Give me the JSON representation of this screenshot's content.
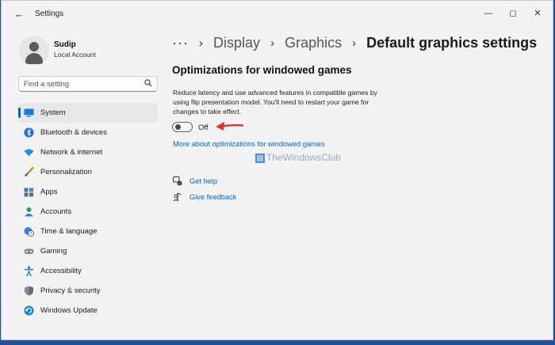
{
  "window": {
    "title": "Settings"
  },
  "user": {
    "name": "Sudip",
    "account": "Local Account"
  },
  "search": {
    "placeholder": "Find a setting"
  },
  "sidebar": {
    "items": [
      {
        "label": "System",
        "icon": "monitor-icon",
        "selected": true
      },
      {
        "label": "Bluetooth & devices",
        "icon": "bluetooth-icon"
      },
      {
        "label": "Network & internet",
        "icon": "wifi-icon"
      },
      {
        "label": "Personalization",
        "icon": "paintbrush-icon"
      },
      {
        "label": "Apps",
        "icon": "apps-icon"
      },
      {
        "label": "Accounts",
        "icon": "person-icon"
      },
      {
        "label": "Time & language",
        "icon": "globe-clock-icon"
      },
      {
        "label": "Gaming",
        "icon": "gamepad-icon"
      },
      {
        "label": "Accessibility",
        "icon": "accessibility-icon"
      },
      {
        "label": "Privacy & security",
        "icon": "shield-icon"
      },
      {
        "label": "Windows Update",
        "icon": "update-icon"
      }
    ]
  },
  "breadcrumb": {
    "overflow": "···",
    "items": [
      "Display",
      "Graphics"
    ],
    "current": "Default graphics settings"
  },
  "main": {
    "section_title": "Optimizations for windowed games",
    "description": "Reduce latency and use advanced features in compatible games by using flip presentation model. You'll need to restart your game for changes to take effect.",
    "toggle": {
      "state": "Off",
      "on": false
    },
    "more_link": "More about optimizations for windowed games",
    "help": [
      {
        "label": "Get help",
        "icon": "help-icon"
      },
      {
        "label": "Give feedback",
        "icon": "feedback-icon"
      }
    ]
  },
  "watermark": {
    "text": "TheWindowsClub"
  },
  "colors": {
    "accent": "#0067c0",
    "arrow": "#e0303a",
    "background": "#f3f3f3"
  }
}
